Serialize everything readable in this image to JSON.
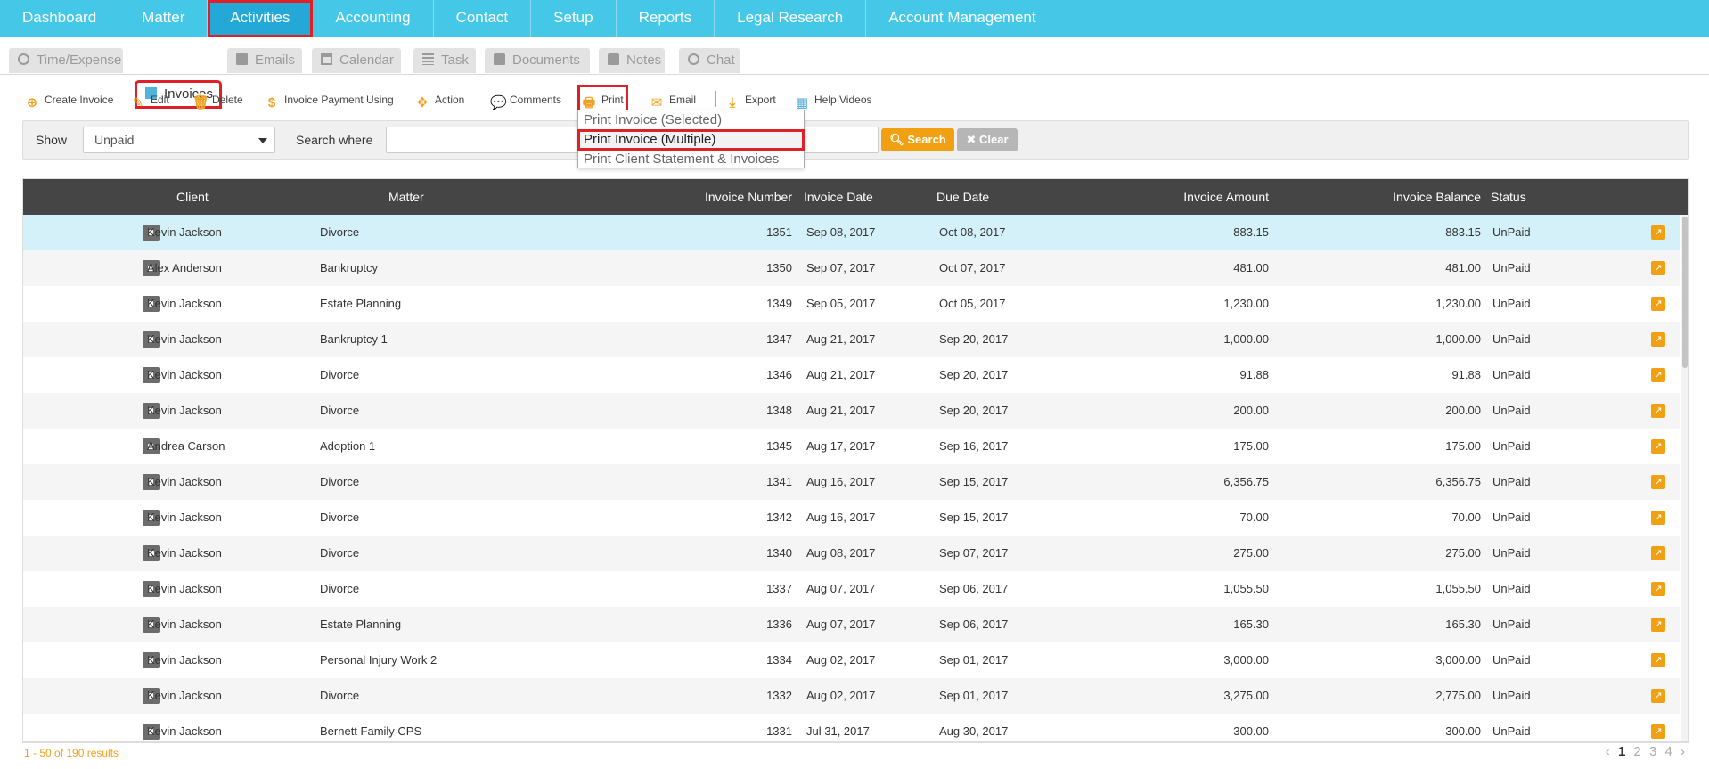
{
  "top_nav": [
    "Dashboard",
    "Matter",
    "Activities",
    "Accounting",
    "Contact",
    "Setup",
    "Reports",
    "Legal Research",
    "Account Management"
  ],
  "sub_tabs": [
    "Time/Expense",
    "Invoices",
    "Emails",
    "Calendar",
    "Task",
    "Documents",
    "Notes",
    "Chat"
  ],
  "toolbar": {
    "create_invoice": "Create Invoice",
    "edit": "Edit",
    "delete": "Delete",
    "invoice_payment": "Invoice Payment Using",
    "action": "Action",
    "comments": "Comments",
    "print": "Print",
    "email": "Email",
    "export": "Export",
    "help_videos": "Help Videos"
  },
  "print_menu": [
    "Print Invoice (Selected)",
    "Print Invoice (Multiple)",
    "Print Client Statement & Invoices"
  ],
  "filter": {
    "show_label": "Show",
    "show_value": "Unpaid",
    "search_where_label": "Search where",
    "search_where_value": "",
    "search_button": "Search",
    "clear_button": "Clear"
  },
  "table": {
    "headers": [
      "Client",
      "Matter",
      "Invoice Number",
      "Invoice Date",
      "Due Date",
      "Invoice Amount",
      "Invoice Balance",
      "Status"
    ],
    "rows": [
      {
        "client": "Kevin Jackson",
        "matter": "Divorce",
        "number": "1351",
        "date": "Sep 08, 2017",
        "due": "Oct 08, 2017",
        "amount": "883.15",
        "balance": "883.15",
        "status": "UnPaid",
        "locked": false
      },
      {
        "client": "Alex Anderson",
        "matter": "Bankruptcy",
        "number": "1350",
        "date": "Sep 07, 2017",
        "due": "Oct 07, 2017",
        "amount": "481.00",
        "balance": "481.00",
        "status": "UnPaid",
        "locked": false
      },
      {
        "client": "Kevin Jackson",
        "matter": "Estate Planning",
        "number": "1349",
        "date": "Sep 05, 2017",
        "due": "Oct 05, 2017",
        "amount": "1,230.00",
        "balance": "1,230.00",
        "status": "UnPaid",
        "locked": false
      },
      {
        "client": "Kevin Jackson",
        "matter": "Bankruptcy 1",
        "number": "1347",
        "date": "Aug 21, 2017",
        "due": "Sep 20, 2017",
        "amount": "1,000.00",
        "balance": "1,000.00",
        "status": "UnPaid",
        "locked": false
      },
      {
        "client": "Kevin Jackson",
        "matter": "Divorce",
        "number": "1346",
        "date": "Aug 21, 2017",
        "due": "Sep 20, 2017",
        "amount": "91.88",
        "balance": "91.88",
        "status": "UnPaid",
        "locked": false
      },
      {
        "client": "Kevin Jackson",
        "matter": "Divorce",
        "number": "1348",
        "date": "Aug 21, 2017",
        "due": "Sep 20, 2017",
        "amount": "200.00",
        "balance": "200.00",
        "status": "UnPaid",
        "locked": false
      },
      {
        "client": "Andrea Carson",
        "matter": "Adoption 1",
        "number": "1345",
        "date": "Aug 17, 2017",
        "due": "Sep 16, 2017",
        "amount": "175.00",
        "balance": "175.00",
        "status": "UnPaid",
        "locked": false
      },
      {
        "client": "Kevin Jackson",
        "matter": "Divorce",
        "number": "1341",
        "date": "Aug 16, 2017",
        "due": "Sep 15, 2017",
        "amount": "6,356.75",
        "balance": "6,356.75",
        "status": "UnPaid",
        "locked": false
      },
      {
        "client": "Kevin Jackson",
        "matter": "Divorce",
        "number": "1342",
        "date": "Aug 16, 2017",
        "due": "Sep 15, 2017",
        "amount": "70.00",
        "balance": "70.00",
        "status": "UnPaid",
        "locked": false
      },
      {
        "client": "Kevin Jackson",
        "matter": "Divorce",
        "number": "1340",
        "date": "Aug 08, 2017",
        "due": "Sep 07, 2017",
        "amount": "275.00",
        "balance": "275.00",
        "status": "UnPaid",
        "locked": true
      },
      {
        "client": "Kevin Jackson",
        "matter": "Divorce",
        "number": "1337",
        "date": "Aug 07, 2017",
        "due": "Sep 06, 2017",
        "amount": "1,055.50",
        "balance": "1,055.50",
        "status": "UnPaid",
        "locked": false
      },
      {
        "client": "Kevin Jackson",
        "matter": "Estate Planning",
        "number": "1336",
        "date": "Aug 07, 2017",
        "due": "Sep 06, 2017",
        "amount": "165.30",
        "balance": "165.30",
        "status": "UnPaid",
        "locked": false
      },
      {
        "client": "Kevin Jackson",
        "matter": "Personal Injury Work 2",
        "number": "1334",
        "date": "Aug 02, 2017",
        "due": "Sep 01, 2017",
        "amount": "3,000.00",
        "balance": "3,000.00",
        "status": "UnPaid",
        "locked": false
      },
      {
        "client": "Kevin Jackson",
        "matter": "Divorce",
        "number": "1332",
        "date": "Aug 02, 2017",
        "due": "Sep 01, 2017",
        "amount": "3,275.00",
        "balance": "2,775.00",
        "status": "UnPaid",
        "locked": false
      },
      {
        "client": "Kevin Jackson",
        "matter": "Bernett Family CPS",
        "number": "1331",
        "date": "Jul 31, 2017",
        "due": "Aug 30, 2017",
        "amount": "300.00",
        "balance": "300.00",
        "status": "UnPaid",
        "locked": false
      }
    ]
  },
  "footer": {
    "results": "1 - 50 of 190 results",
    "prev": "‹",
    "pages": [
      "1",
      "2",
      "3",
      "4"
    ],
    "next": "›"
  },
  "colors": {
    "nav_bg": "#45c8e8",
    "accent_orange": "#f0a010",
    "highlight_red": "#e01f26",
    "selected_row": "#d4f1f9"
  }
}
